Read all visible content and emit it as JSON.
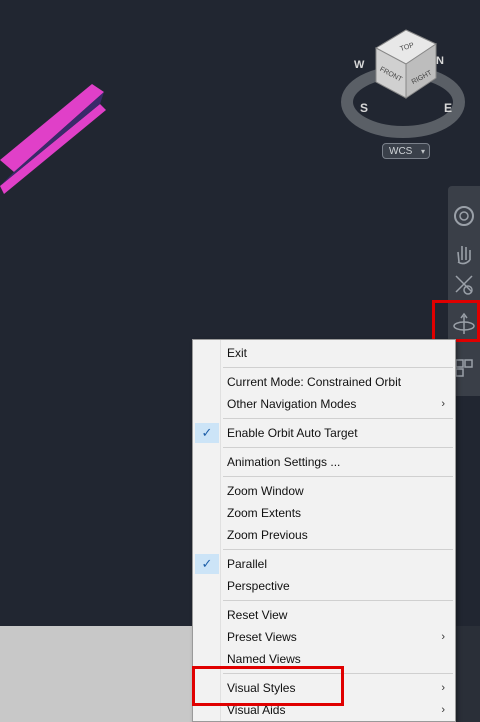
{
  "viewcube": {
    "faces": {
      "top": "TOP",
      "front": "FRONT",
      "right": "RIGHT"
    },
    "compass": {
      "w": "W",
      "n": "N",
      "s": "S",
      "e": "E"
    },
    "ucs_label": "WCS"
  },
  "navbar": {
    "icons": [
      "steering-wheel-icon",
      "pan-icon",
      "zoom-icon",
      "orbit-icon",
      "showmotion-icon"
    ]
  },
  "context_menu": {
    "items": [
      {
        "label": "Exit"
      },
      {
        "label": "Current Mode: Constrained Orbit"
      },
      {
        "label": "Other Navigation Modes",
        "submenu": true
      },
      {
        "label": "Enable Orbit Auto Target",
        "checked": true
      },
      {
        "label": "Animation Settings ..."
      },
      {
        "label": "Zoom Window"
      },
      {
        "label": "Zoom Extents"
      },
      {
        "label": "Zoom Previous"
      },
      {
        "label": "Parallel",
        "checked": true
      },
      {
        "label": "Perspective"
      },
      {
        "label": "Reset View"
      },
      {
        "label": "Preset Views",
        "submenu": true
      },
      {
        "label": "Named Views"
      },
      {
        "label": "Visual Styles",
        "submenu": true
      },
      {
        "label": "Visual Aids",
        "submenu": true
      }
    ],
    "submenu_arrow": "›",
    "check_mark": "✓"
  },
  "colors": {
    "viewport_bg": "#212631",
    "geometry": "#e040c8",
    "highlight": "#e00000",
    "menu_bg": "#f2f2f2",
    "check_bg": "#cce4f7"
  }
}
